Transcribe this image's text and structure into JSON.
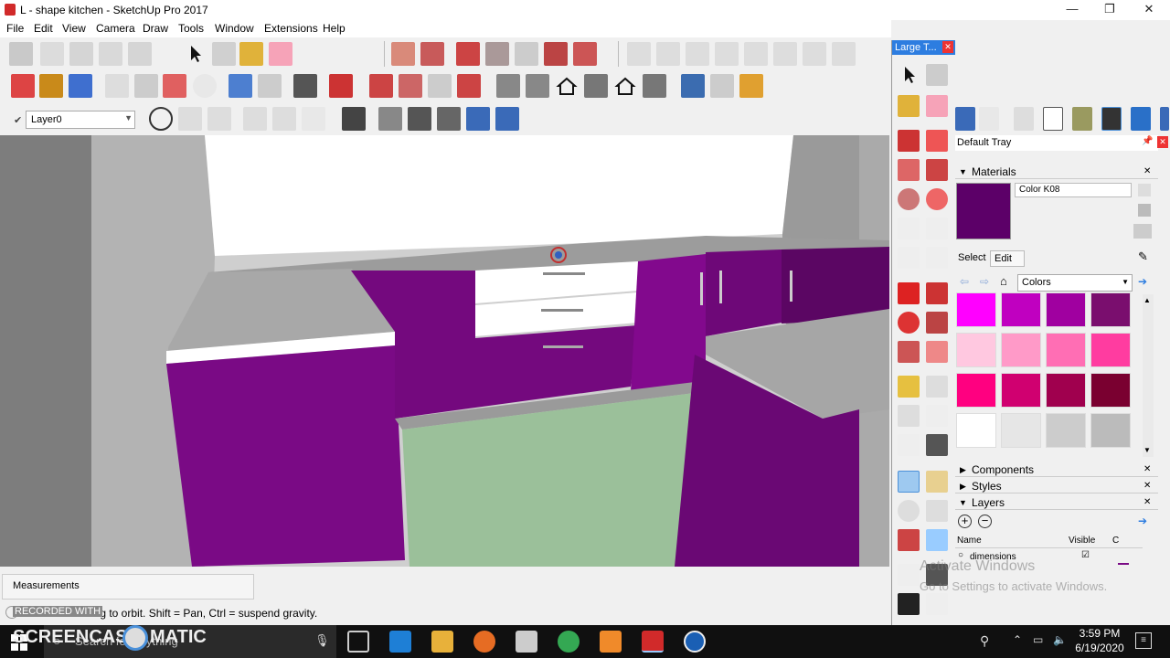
{
  "window": {
    "title": "L -  shape kitchen - SketchUp Pro 2017",
    "minimize": "—",
    "restore": "❐",
    "close": "✕"
  },
  "menu": [
    "File",
    "Edit",
    "View",
    "Camera",
    "Draw",
    "Tools",
    "Window",
    "Extensions",
    "Help"
  ],
  "layer": {
    "current": "Layer0"
  },
  "right_toolbar": {
    "title": "Large T..."
  },
  "tray": {
    "title": "Default Tray",
    "materials": {
      "header": "Materials",
      "material_name": "Color K08",
      "tab_select": "Select",
      "tab_edit": "Edit",
      "collection": "Colors",
      "swatches": [
        "#ff00ff",
        "#c000c0",
        "#a000a0",
        "#7a0e6e",
        "#ffc8e0",
        "#ff9ac8",
        "#ff6eb4",
        "#ff3ca0",
        "#ff0080",
        "#d00070",
        "#a0004e",
        "#7a0030",
        "#ffffff",
        "#e6e6e6",
        "#cccccc",
        "#bbbbbb"
      ],
      "preview_color": "#5c0068"
    },
    "components": "Components",
    "styles": "Styles",
    "layers": {
      "header": "Layers",
      "col_name": "Name",
      "col_visible": "Visible",
      "col_c": "C",
      "rows": [
        {
          "name": "dimensions",
          "visible": "☑"
        }
      ]
    }
  },
  "status": {
    "measurements": "Measurements",
    "hint": "Drag to orbit. Shift = Pan, Ctrl = suspend gravity."
  },
  "taskbar": {
    "search": "Search for anything",
    "time": "3:59 PM",
    "date": "6/19/2020"
  },
  "watermarks": {
    "activate": "Activate Windows",
    "activate_sub": "Go to Settings to activate Windows.",
    "recorded": "RECORDED WITH",
    "screencast": "SCREENCAST",
    "omatic": "MATIC"
  },
  "colors": {
    "accent": "#2d7de0",
    "cabinet_purple": "#7a0a85",
    "floor_green": "#9bc09a"
  }
}
